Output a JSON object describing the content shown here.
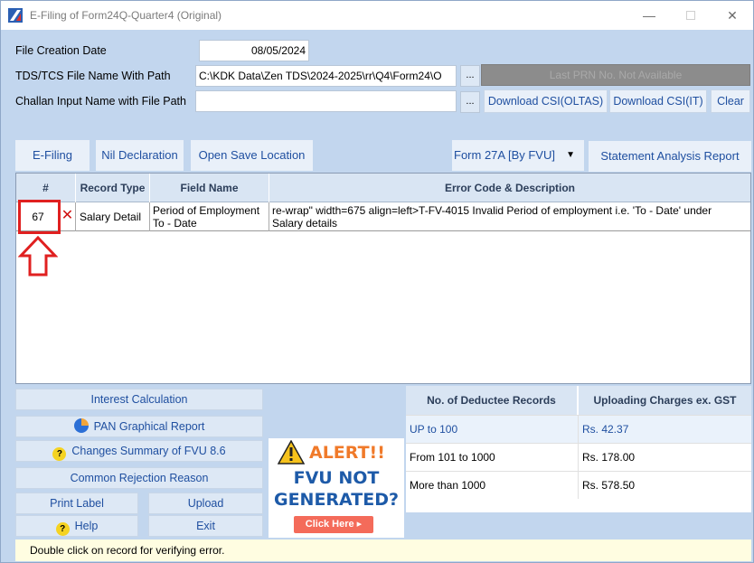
{
  "window": {
    "title": "E-Filing of Form24Q-Quarter4 (Original)"
  },
  "form": {
    "file_creation_date_label": "File Creation Date",
    "file_creation_date_value": "08/05/2024",
    "tds_file_label": "TDS/TCS File Name With Path",
    "tds_file_value": "C:\\KDK Data\\Zen TDS\\2024-2025\\rr\\Q4\\Form24\\O",
    "challan_label": "Challan Input Name with File Path",
    "challan_value": "",
    "browse": "...",
    "prn_text": "Last PRN No. Not Available",
    "download_oltas": "Download CSI(OLTAS)",
    "download_it": "Download CSI(IT)",
    "clear": "Clear"
  },
  "toolbar": {
    "efiling": "E-Filing",
    "nil": "Nil Declaration",
    "open_save": "Open Save Location",
    "form_select": "Form 27A [By FVU]",
    "statement": "Statement Analysis Report"
  },
  "grid": {
    "headers": [
      "#",
      "Record Type",
      "Field Name",
      "Error Code & Description"
    ],
    "rows": [
      {
        "num": "67",
        "record_type": "Salary Detail",
        "field_line1": "Period of Employment",
        "field_line2": "To - Date",
        "desc_line1": "re-wrap\" width=675 align=left>T-FV-4015 Invalid Period of employment i.e. 'To - Date' under",
        "desc_line2": "Salary details"
      }
    ]
  },
  "left_buttons": {
    "interest": "Interest Calculation",
    "pan": "PAN Graphical Report",
    "changes": "Changes Summary of FVU 8.6",
    "rejection": "Common Rejection Reason",
    "print_label": "Print Label",
    "upload": "Upload",
    "help": "Help",
    "exit": "Exit"
  },
  "alert": {
    "title": "ALERT!!",
    "line1": "FVU NOT",
    "line2": "GENERATED?",
    "cta": "Click Here ▸"
  },
  "charges": {
    "headers": [
      "No. of Deductee Records",
      "Uploading Charges ex. GST"
    ],
    "rows": [
      {
        "records": "UP to 100",
        "charge": "Rs. 42.37"
      },
      {
        "records": "From 101 to 1000",
        "charge": "Rs. 178.00"
      },
      {
        "records": "More than 1000",
        "charge": "Rs. 578.50"
      }
    ]
  },
  "status": {
    "text": "Double click on record for verifying error."
  },
  "colors": {
    "accent": "#1f4fa0",
    "panel": "#c2d6ee",
    "highlight": "#e02020",
    "alert_orange": "#f07a2a"
  }
}
